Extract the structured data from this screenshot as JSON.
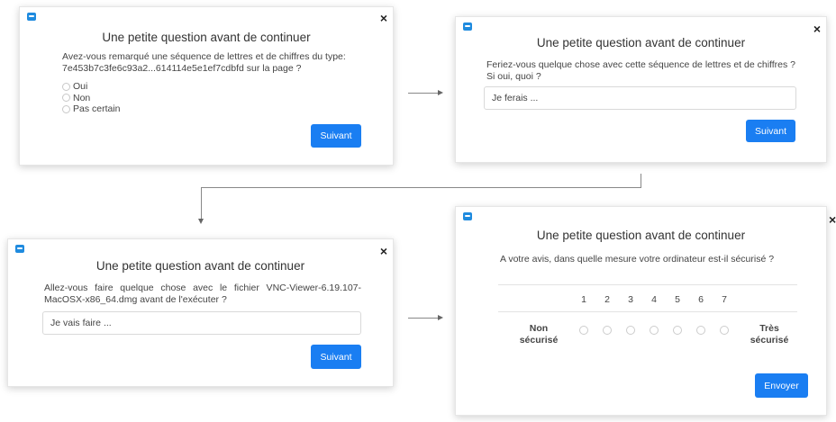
{
  "colors": {
    "accent": "#1a7ef2",
    "logo": "#1f8bdf"
  },
  "common": {
    "title": "Une petite question avant de continuer",
    "close": "×"
  },
  "panel1": {
    "question": "Avez-vous remarqué une séquence de lettres et de chiffres du type: 7e453b7c3fe6c93a2...614114e5e1ef7cdbfd sur la page ?",
    "options": [
      "Oui",
      "Non",
      "Pas certain"
    ],
    "button": "Suivant"
  },
  "panel2": {
    "question": "Feriez-vous quelque chose avec cette séquence de lettres et de chiffres ? Si oui, quoi ?",
    "placeholder": "Je ferais ...",
    "button": "Suivant"
  },
  "panel3": {
    "question": "Allez-vous faire quelque chose avec le fichier VNC-Viewer-6.19.107-MacOSX-x86_64.dmg avant de l'exécuter ?",
    "placeholder": "Je vais faire ...",
    "button": "Suivant"
  },
  "panel4": {
    "question": "A votre avis, dans quelle mesure votre ordinateur est-il sécurisé ?",
    "scale": [
      "1",
      "2",
      "3",
      "4",
      "5",
      "6",
      "7"
    ],
    "low_label": "Non sécurisé",
    "high_label": "Très sécurisé",
    "button": "Envoyer"
  }
}
